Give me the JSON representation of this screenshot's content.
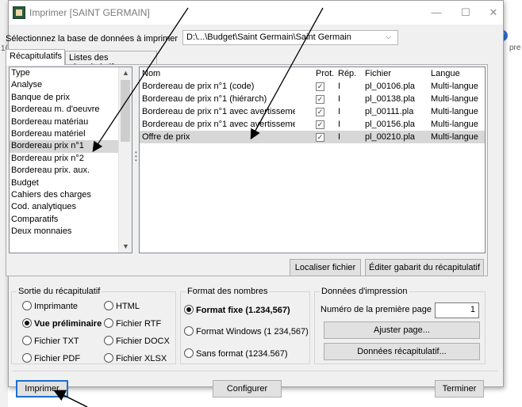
{
  "background": {
    "left_text": "1(",
    "right_text": "pre",
    "help_text": "?"
  },
  "window": {
    "title": "Imprimer [SAINT GERMAIN]",
    "minimize": "—",
    "maximize": "☐",
    "close": "✕"
  },
  "database": {
    "label": "Sélectionnez la base de données à imprimer",
    "value": "D:\\...\\Budget\\Saint Germain\\Saint Germain"
  },
  "tabs": [
    {
      "label": "Récapitulatifs"
    },
    {
      "label": "Listes des récapitulatifs"
    }
  ],
  "type_list": {
    "header": "Type",
    "items": [
      "Analyse",
      "Banque de prix",
      "Bordereau m. d'oeuvre",
      "Bordereau matériau",
      "Bordereau matériel",
      "Bordereau prix n°1",
      "Bordereau prix n°2",
      "Bordereau prix. aux.",
      "Budget",
      "Cahiers des charges",
      "Cod. analytiques",
      "Comparatifs",
      "Deux monnaies"
    ],
    "selected": "Bordereau prix n°1"
  },
  "file_table": {
    "columns": [
      "Nom",
      "Prot.",
      "Rép.",
      "Fichier",
      "Langue"
    ],
    "rows": [
      {
        "nom": "Bordereau de prix n°1 (code)",
        "prot": "✓",
        "rep": "I",
        "fichier": "pl_00106.pla",
        "langue": "Multi-langue"
      },
      {
        "nom": "Bordereau de prix n°1 (hiérarch)",
        "prot": "✓",
        "rep": "I",
        "fichier": "pl_00138.pla",
        "langue": "Multi-langue"
      },
      {
        "nom": "Bordereau de prix n°1 avec avertisseme...",
        "prot": "✓",
        "rep": "I",
        "fichier": "pl_00111.pla",
        "langue": "Multi-langue"
      },
      {
        "nom": "Bordereau de prix n°1 avec avertisseme...",
        "prot": "✓",
        "rep": "I",
        "fichier": "pl_00156.pla",
        "langue": "Multi-langue"
      },
      {
        "nom": "Offre de prix",
        "prot": "✓",
        "rep": "I",
        "fichier": "pl_00210.pla",
        "langue": "Multi-langue"
      }
    ],
    "selected_index": 4
  },
  "buttons": {
    "localiser": "Localiser fichier",
    "editer": "Éditer gabarit du récapitulatif",
    "ajuster": "Ajuster page...",
    "donnees": "Données récapitulatif...",
    "imprimer": "Imprimer",
    "configurer": "Configurer",
    "terminer": "Terminer"
  },
  "sortie": {
    "title": "Sortie du récapitulatif",
    "options": [
      "Imprimante",
      "HTML",
      "Vue préliminaire",
      "Fichier RTF",
      "Fichier TXT",
      "Fichier DOCX",
      "Fichier PDF",
      "Fichier XLSX"
    ],
    "selected": "Vue préliminaire"
  },
  "format": {
    "title": "Format des nombres",
    "options": [
      "Format fixe (1.234,567)",
      "Format Windows (1 234,567)",
      "Sans format (1234.567)"
    ],
    "selected": "Format fixe (1.234,567)"
  },
  "impression": {
    "title": "Données d'impression",
    "first_page_label": "Numéro de la première page",
    "first_page_value": "1"
  },
  "colors": {
    "selection": "#d7d7d7",
    "focus_border": "#1a6fd2",
    "annotation_arrow": "#000000"
  }
}
